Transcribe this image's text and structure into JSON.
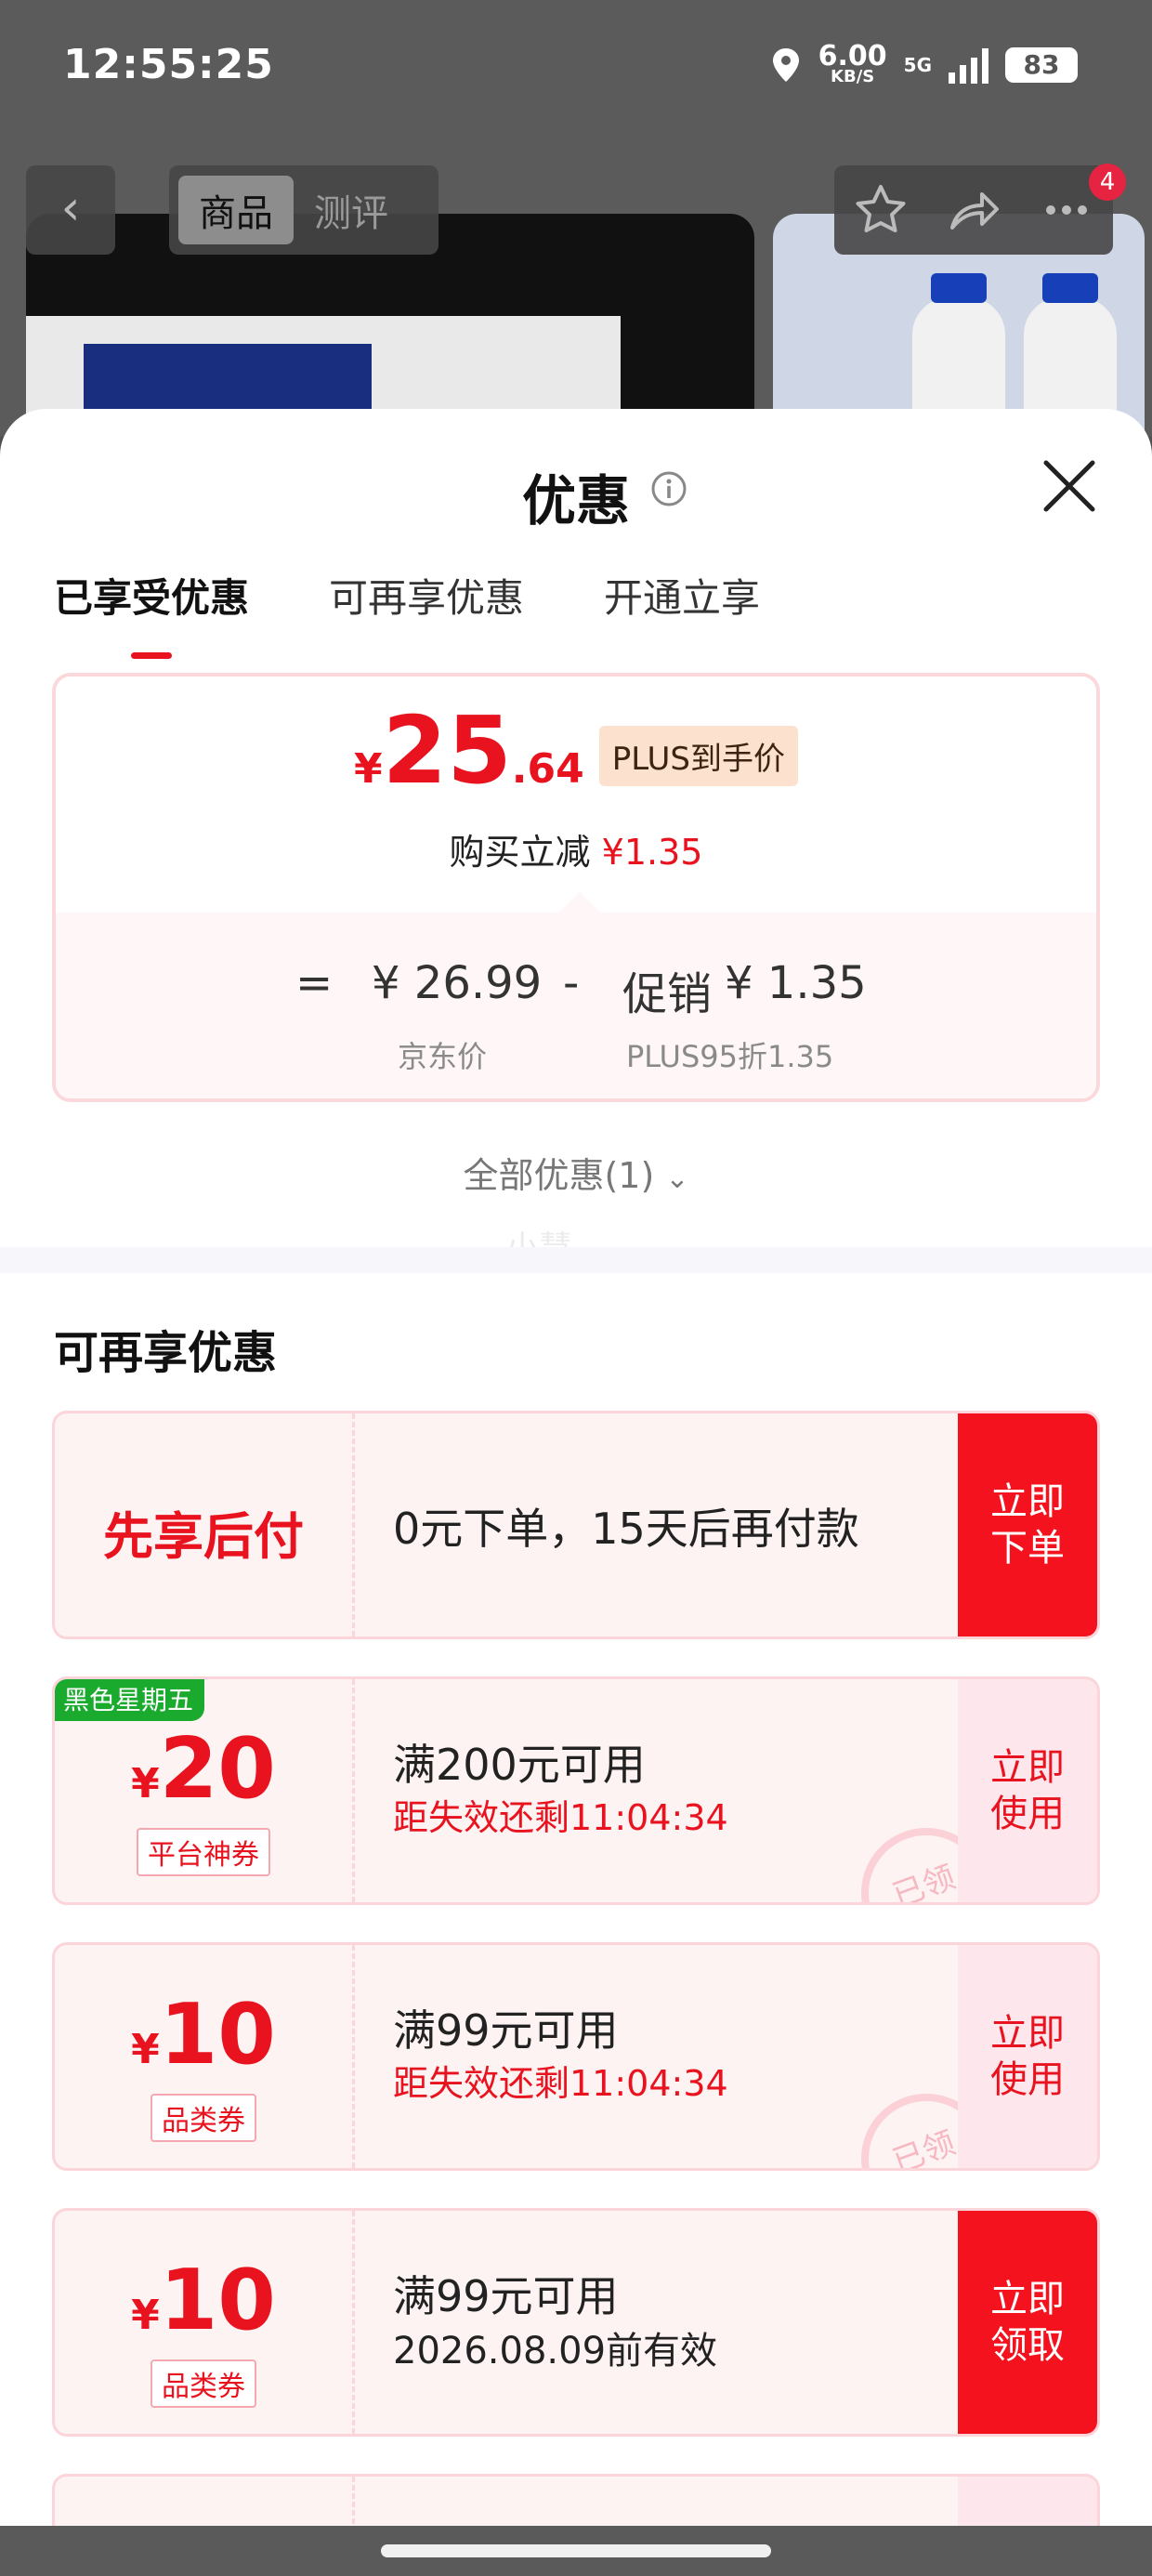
{
  "status_bar": {
    "time": "12:55:25",
    "net_speed": "6.00",
    "net_unit": "KB/S",
    "network": "5G",
    "battery": "83"
  },
  "product_nav": {
    "tab_goods": "商品",
    "tab_reviews": "测评",
    "cart_badge": "4"
  },
  "sheet": {
    "title": "优惠"
  },
  "tabs": [
    "已享受优惠",
    "可再享优惠",
    "开通立享"
  ],
  "price_card": {
    "currency": "¥",
    "price_int": "25",
    "price_dec": ".64",
    "plus_tag": "PLUS到手价",
    "reduce_label": "购买立减",
    "reduce_amount": "¥1.35",
    "equals": "=",
    "base_price": "¥ 26.99",
    "minus": "-",
    "promo_label": "促销",
    "promo_amount": "¥ 1.35",
    "base_label": "京东价",
    "promo_detail": "PLUS95折1.35"
  },
  "all_offers": {
    "label": "全部优惠(1)"
  },
  "watermark": "小慧",
  "section": {
    "title": "可再享优惠"
  },
  "coupons": [
    {
      "headline": "先享后付",
      "desc": "0元下单，15天后再付款",
      "action": "立即\n下单"
    },
    {
      "corner_tag": "黑色星期五",
      "currency": "¥",
      "amount": "20",
      "type_tag": "平台神券",
      "condition": "满200元可用",
      "timer": "距失效还剩11:04:34",
      "action": "立即\n使用",
      "stamp": "已领"
    },
    {
      "currency": "¥",
      "amount": "10",
      "type_tag": "品类券",
      "condition": "满99元可用",
      "timer": "距失效还剩11:04:34",
      "action": "立即\n使用",
      "stamp": "已领"
    },
    {
      "currency": "¥",
      "amount": "10",
      "type_tag": "品类券",
      "condition": "满99元可用",
      "validity": "2026.08.09前有效",
      "action": "立即\n领取"
    }
  ],
  "colors": {
    "accent_red": "#e8131f",
    "tag_green": "#1aab2e"
  }
}
